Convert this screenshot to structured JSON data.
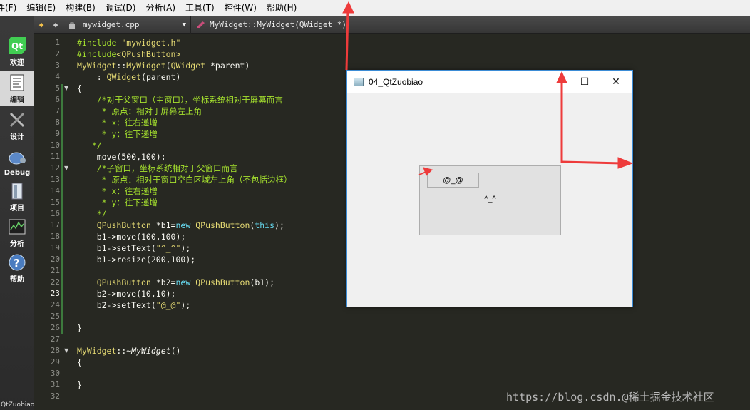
{
  "menu": [
    "件(F)",
    "编辑(E)",
    "构建(B)",
    "调试(D)",
    "分析(A)",
    "工具(T)",
    "控件(W)",
    "帮助(H)"
  ],
  "sidebar": {
    "items": [
      {
        "label": "欢迎",
        "icon": "qt-logo-icon"
      },
      {
        "label": "编辑",
        "icon": "edit-document-icon"
      },
      {
        "label": "设计",
        "icon": "design-tools-icon"
      },
      {
        "label": "Debug",
        "icon": "debug-bug-icon"
      },
      {
        "label": "项目",
        "icon": "project-file-icon"
      },
      {
        "label": "分析",
        "icon": "analyze-chart-icon"
      },
      {
        "label": "帮助",
        "icon": "help-question-icon"
      }
    ],
    "project_label": "QtZuobiao"
  },
  "editor_tabs": {
    "file_name": "mywidget.cpp",
    "symbol": "MyWidget::MyWidget(QWidget *)"
  },
  "current_line": 23,
  "code_lines": [
    "#include \"mywidget.h\"",
    "#include<QPushButton>",
    "MyWidget::MyWidget(QWidget *parent)",
    "    : QWidget(parent)",
    "{",
    "    /*对于父窗口（主窗口），坐标系统相对于屏幕而言",
    "     * 原点：相对于屏幕左上角",
    "     * x：往右递增",
    "     * y：往下递增",
    "   */",
    "    move(500,100);",
    "    /*子窗口，坐标系统相对于父窗口而言",
    "     * 原点：相对于窗口空白区域左上角（不包括边框）",
    "     * x：往右递增",
    "     * y：往下递增",
    "    */",
    "    QPushButton *b1=new QPushButton(this);",
    "    b1->move(100,100);",
    "    b1->setText(\"^_^\");",
    "    b1->resize(200,100);",
    "",
    "    QPushButton *b2=new QPushButton(b1);",
    "    b2->move(10,10);",
    "    b2->setText(\"@_@\");",
    "",
    "}",
    "",
    "MyWidget::~MyWidget()",
    "{",
    "",
    "}",
    ""
  ],
  "qt_window": {
    "title": "04_QtZuobiao",
    "minimize": "—",
    "maximize": "☐",
    "close": "✕",
    "button1_text": "^_^",
    "button2_text": "@_@"
  },
  "watermark": "https://blog.csdn.@稀土掘金技术社区",
  "colors": {
    "arrow": "#ee3b3b",
    "editor_bg": "#272822",
    "keyword": "#66d9ef",
    "string": "#e6db74",
    "comment": "#a6e22e"
  }
}
